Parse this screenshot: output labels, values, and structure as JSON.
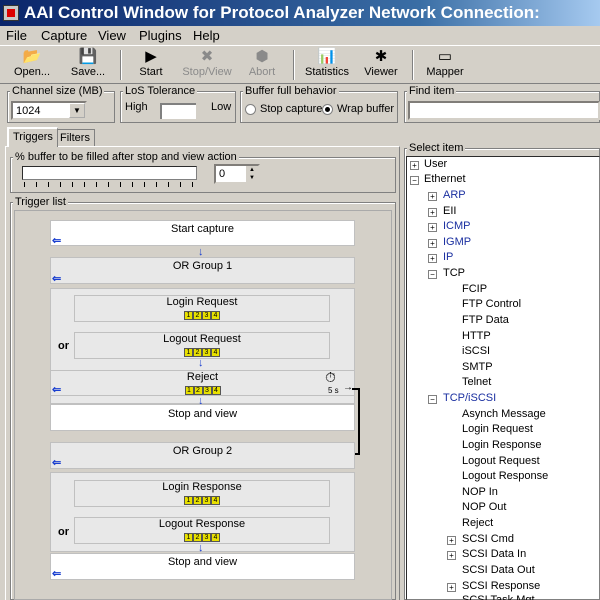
{
  "window": {
    "title": "AAI Control Window for Protocol Analyzer  Network Connection:"
  },
  "menu": [
    "File",
    "Capture",
    "View",
    "Plugins",
    "Help"
  ],
  "toolbar": {
    "open": "Open...",
    "save": "Save...",
    "start": "Start",
    "stop_view": "Stop/View",
    "abort": "Abort",
    "statistics": "Statistics",
    "viewer": "Viewer",
    "mapper": "Mapper"
  },
  "settings": {
    "channel_size_label": "Channel size (MB)",
    "channel_size_value": "1024",
    "los_label": "LoS Tolerance",
    "los_high": "High",
    "los_low": "Low",
    "buffer_label": "Buffer full behavior",
    "stop_capture": "Stop capture",
    "wrap_buffer": "Wrap buffer",
    "buffer_selected": "wrap",
    "find_label": "Find item"
  },
  "tabs": {
    "triggers": "Triggers",
    "filters": "Filters"
  },
  "buffer_fill": {
    "label": "% buffer to be filled after stop and view action",
    "value": "0",
    "slider_fraction": 0
  },
  "trigger": {
    "label": "Trigger list",
    "start": "Start capture",
    "or_group1": "OR Group 1",
    "login_request": "Login Request",
    "logout_request": "Logout Request",
    "reject": "Reject",
    "or": "or",
    "stop_view": "Stop and view",
    "timer": "5 s",
    "or_group2": "OR Group 2",
    "login_response": "Login Response",
    "logout_response": "Logout Response",
    "nums": [
      "1",
      "2",
      "3",
      "4"
    ]
  },
  "select": {
    "label": "Select item",
    "items": [
      "User",
      "Ethernet",
      "ARP",
      "EII",
      "ICMP",
      "IGMP",
      "IP",
      "TCP",
      "FCIP",
      "FTP Control",
      "FTP Data",
      "HTTP",
      "iSCSI",
      "SMTP",
      "Telnet",
      "TCP/iSCSI",
      "Asynch Message",
      "Login Request",
      "Login Response",
      "Logout Request",
      "Logout Response",
      "NOP In",
      "NOP Out",
      "Reject",
      "SCSI Cmd",
      "SCSI Data In",
      "SCSI Data Out",
      "SCSI Response",
      "SCSI Task Mgt"
    ]
  }
}
